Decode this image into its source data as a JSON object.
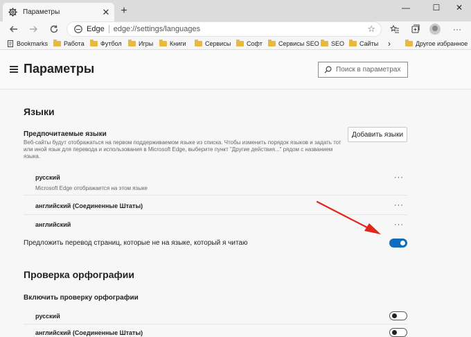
{
  "window": {
    "tab_title": "Параметры",
    "new_tab": "+",
    "close_tab": "✕",
    "minimize": "—",
    "maximize": "☐",
    "close": "✕"
  },
  "navbar": {
    "site_label": "Edge",
    "url": "edge://settings/languages"
  },
  "bookmarks": {
    "items": [
      "Bookmarks",
      "Работа",
      "Футбол",
      "Игры",
      "Книги",
      "Сервисы",
      "Софт",
      "Сервисы SEO",
      "SEO",
      "Сайты"
    ],
    "overflow": "›",
    "other": "Другое избранное"
  },
  "header": {
    "title": "Параметры",
    "search_placeholder": "Поиск в параметрах"
  },
  "languages": {
    "title": "Языки",
    "preferred_label": "Предпочитаемые языки",
    "preferred_desc": "Веб-сайты будут отображаться на первом поддерживаемом языке из списка. Чтобы изменить порядок языков и задать тот или иной язык для перевода и использования в Microsoft Edge, выберите пункт \"Другие действия...\" рядом с названием языка.",
    "add_button": "Добавить языки",
    "list": [
      {
        "name": "русский",
        "sub": "Microsoft Edge отображается на этом языке"
      },
      {
        "name": "английский (Соединенные Штаты)",
        "sub": ""
      },
      {
        "name": "английский",
        "sub": ""
      }
    ],
    "more_glyph": "···",
    "translate_label": "Предложить перевод страниц, которые не на языке, который я читаю",
    "translate_on": true
  },
  "spell": {
    "title": "Проверка орфографии",
    "enable_label": "Включить проверку орфографии",
    "list": [
      {
        "name": "русский",
        "on": false
      },
      {
        "name": "английский (Соединенные Штаты)",
        "on": false
      }
    ]
  },
  "colors": {
    "accent": "#0f6cbd",
    "arrow": "#e0261b",
    "folder": "#e8b93d"
  }
}
